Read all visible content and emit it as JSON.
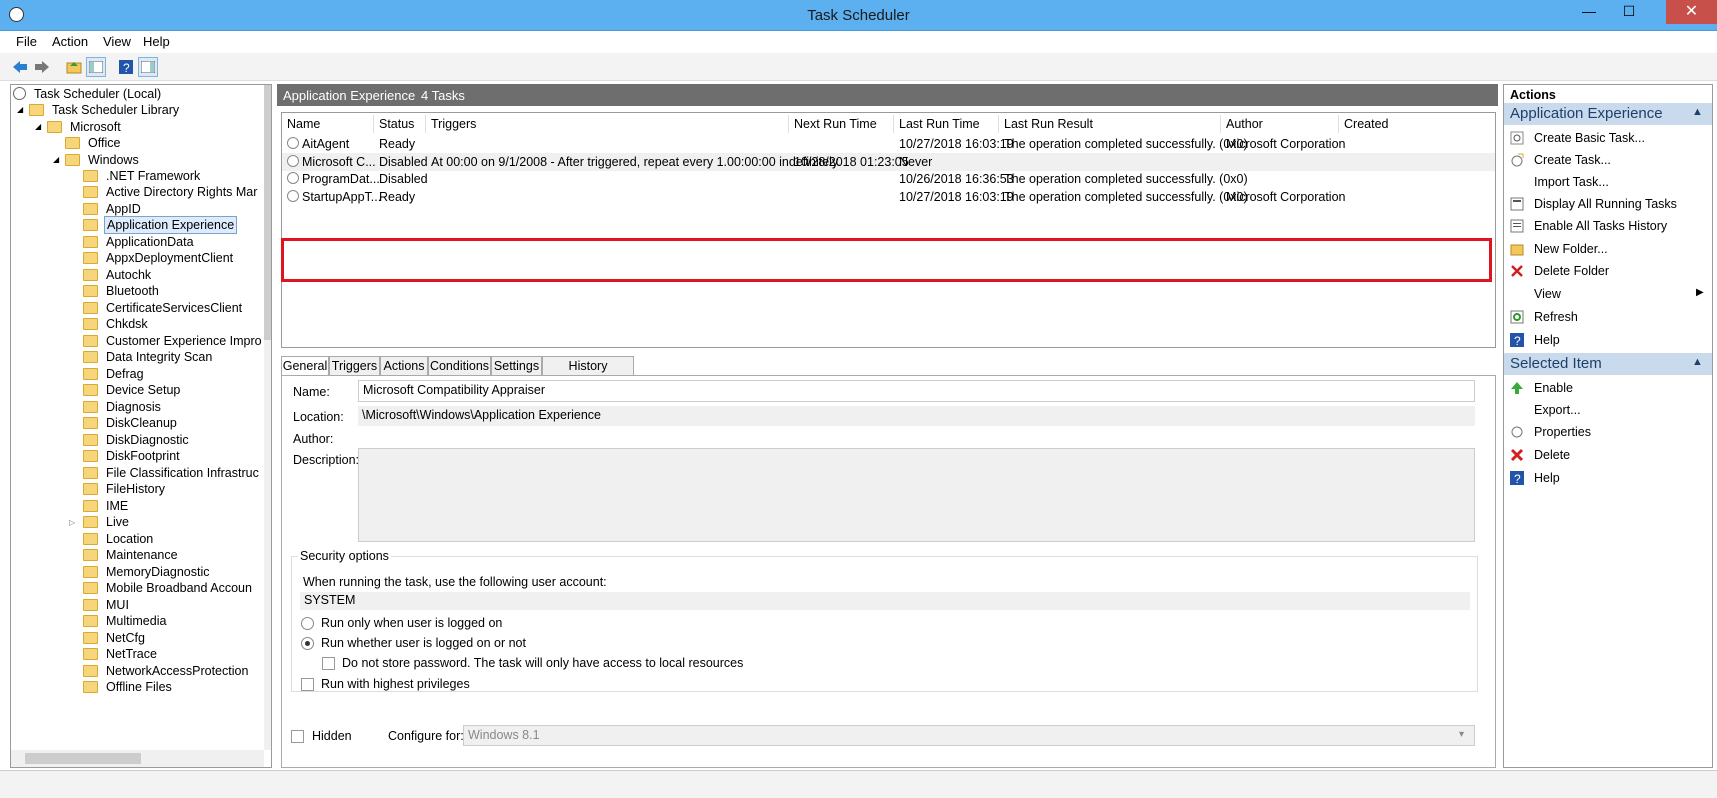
{
  "window": {
    "title": "Task Scheduler",
    "minimize": "—",
    "maximize": "☐",
    "close": "✕"
  },
  "menu": {
    "file": "File",
    "action": "Action",
    "view": "View",
    "help": "Help"
  },
  "tree": {
    "root": "Task Scheduler (Local)",
    "library": "Task Scheduler Library",
    "microsoft": "Microsoft",
    "office": "Office",
    "windows": "Windows",
    "items": [
      ".NET Framework",
      "Active Directory Rights Mar",
      "AppID",
      "Application Experience",
      "ApplicationData",
      "AppxDeploymentClient",
      "Autochk",
      "Bluetooth",
      "CertificateServicesClient",
      "Chkdsk",
      "Customer Experience Impro",
      "Data Integrity Scan",
      "Defrag",
      "Device Setup",
      "Diagnosis",
      "DiskCleanup",
      "DiskDiagnostic",
      "DiskFootprint",
      "File Classification Infrastruc",
      "FileHistory",
      "IME",
      "Live",
      "Location",
      "Maintenance",
      "MemoryDiagnostic",
      "Mobile Broadband Accoun",
      "MUI",
      "Multimedia",
      "NetCfg",
      "NetTrace",
      "NetworkAccessProtection",
      "Offline Files"
    ],
    "selected": "Application Experience"
  },
  "center": {
    "header_title": "Application Experience",
    "header_count": "4 Tasks",
    "columns": [
      "Name",
      "Status",
      "Triggers",
      "Next Run Time",
      "Last Run Time",
      "Last Run Result",
      "Author",
      "Created"
    ],
    "rows": [
      {
        "name": "AitAgent",
        "status": "Ready",
        "triggers": "",
        "next": "",
        "last": "10/27/2018 16:03:19",
        "result": "The operation completed successfully. (0x0)",
        "author": "Microsoft Corporation"
      },
      {
        "name": "Microsoft C...",
        "status": "Disabled",
        "triggers": "At 00:00 on 9/1/2008 - After triggered, repeat every 1.00:00:00 indefinitely.",
        "next": "10/28/2018 01:23:05",
        "last": "Never",
        "result": "",
        "author": ""
      },
      {
        "name": "ProgramDat...",
        "status": "Disabled",
        "triggers": "",
        "next": "",
        "last": "10/26/2018 16:36:53",
        "result": "The operation completed successfully. (0x0)",
        "author": ""
      },
      {
        "name": "StartupAppT...",
        "status": "Ready",
        "triggers": "",
        "next": "",
        "last": "10/27/2018 16:03:19",
        "result": "The operation completed successfully. (0x0)",
        "author": "Microsoft Corporation"
      }
    ]
  },
  "tabs": [
    "General",
    "Triggers",
    "Actions",
    "Conditions",
    "Settings",
    "History (disabled)"
  ],
  "general": {
    "name_label": "Name:",
    "name_value": "Microsoft Compatibility Appraiser",
    "location_label": "Location:",
    "location_value": "\\Microsoft\\Windows\\Application Experience",
    "author_label": "Author:",
    "description_label": "Description:",
    "security_title": "Security options",
    "account_prompt": "When running the task, use the following user account:",
    "account": "SYSTEM",
    "radio1": "Run only when user is logged on",
    "radio2": "Run whether user is logged on or not",
    "nostore": "Do not store password.  The task will only have access to local resources",
    "highest": "Run with highest privileges",
    "hidden": "Hidden",
    "configure_label": "Configure for:",
    "configure_value": "Windows 8.1"
  },
  "actions": {
    "title": "Actions",
    "section1": "Application Experience",
    "items1": [
      "Create Basic Task...",
      "Create Task...",
      "Import Task...",
      "Display All Running Tasks",
      "Enable All Tasks History",
      "New Folder...",
      "Delete Folder",
      "View",
      "Refresh",
      "Help"
    ],
    "section2": "Selected Item",
    "items2": [
      "Enable",
      "Export...",
      "Properties",
      "Delete",
      "Help"
    ]
  }
}
